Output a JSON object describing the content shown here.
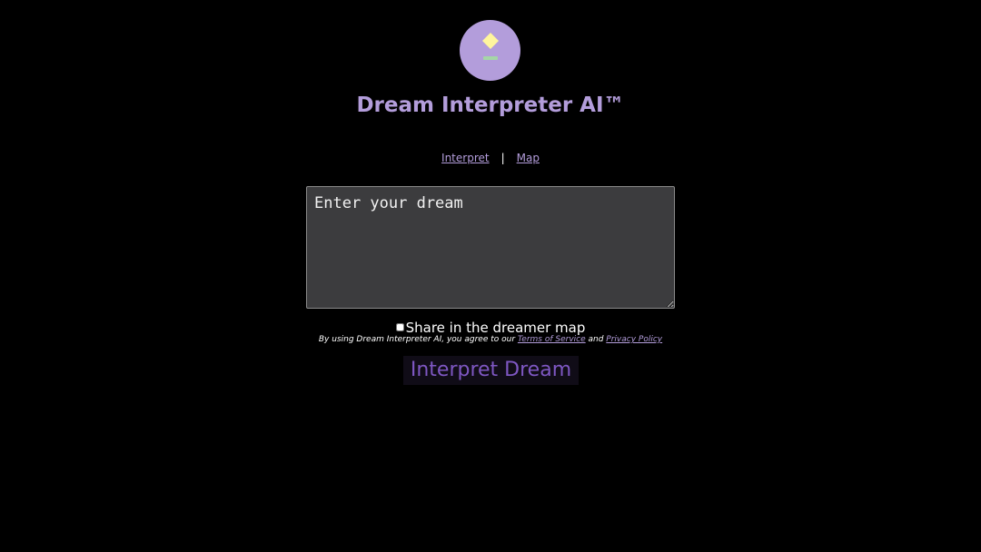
{
  "header": {
    "title": "Dream Interpreter AI™",
    "logo_icon": "dream-lamp-icon"
  },
  "nav": {
    "items": [
      {
        "label": "Interpret"
      },
      {
        "label": "Map"
      }
    ],
    "separator": "|"
  },
  "form": {
    "dream_placeholder": "Enter your dream",
    "dream_value": "",
    "share_label": "Share in the dreamer map",
    "share_checked": false,
    "terms_prefix": "By using Dream Interpreter AI, you agree to our ",
    "terms_link": "Terms of Service",
    "terms_and": " and ",
    "privacy_link": "Privacy Policy",
    "submit_label": "Interpret Dream"
  },
  "colors": {
    "background": "#000000",
    "accent": "#b39ddb",
    "button_text": "#7e57c2",
    "button_bg": "#100c17",
    "textarea_bg": "#3c3c3e",
    "logo_diamond": "#fff59d",
    "logo_bar": "#a5d6a7"
  }
}
